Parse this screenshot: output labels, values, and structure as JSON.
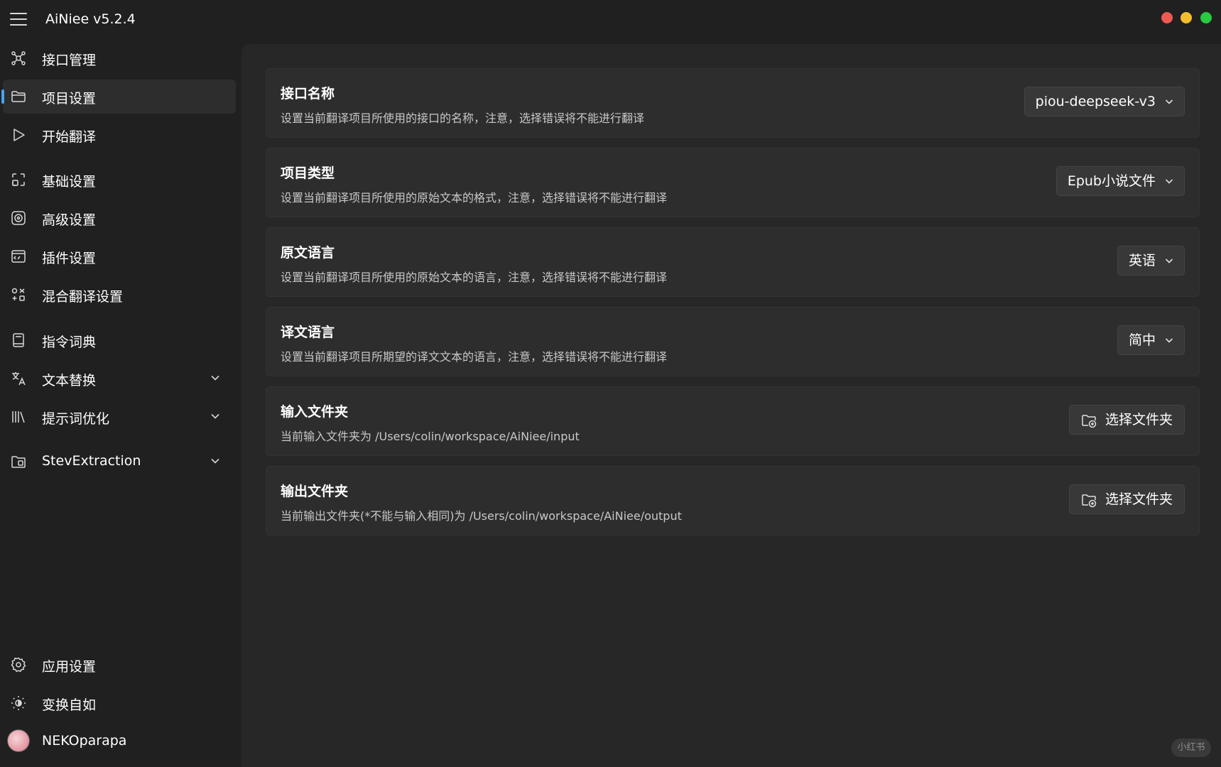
{
  "app": {
    "title": "AiNiee v5.2.4"
  },
  "colors": {
    "accent": "#4aa3f0",
    "background": "#202020",
    "card": "#2d2d2d",
    "close": "#ee5a52",
    "minimize": "#f5bd2e",
    "maximize": "#29c940"
  },
  "sidebar": {
    "items": [
      {
        "label": "接口管理",
        "icon": "network-nodes-icon"
      },
      {
        "label": "项目设置",
        "icon": "folder-icon",
        "active": true
      },
      {
        "label": "开始翻译",
        "icon": "play-icon"
      },
      {
        "label": "基础设置",
        "icon": "frame-icon"
      },
      {
        "label": "高级设置",
        "icon": "target-icon"
      },
      {
        "label": "插件设置",
        "icon": "terminal-icon"
      },
      {
        "label": "混合翻译设置",
        "icon": "mixed-icon"
      },
      {
        "label": "指令词典",
        "icon": "book-icon"
      },
      {
        "label": "文本替换",
        "icon": "translate-icon",
        "expandable": true
      },
      {
        "label": "提示词优化",
        "icon": "library-icon",
        "expandable": true
      },
      {
        "label": "StevExtraction",
        "icon": "extract-icon",
        "expandable": true
      }
    ],
    "footer": [
      {
        "label": "应用设置",
        "icon": "gear-icon"
      },
      {
        "label": "变换自如",
        "icon": "brightness-icon"
      },
      {
        "label": "NEKOparapa",
        "icon": "avatar"
      }
    ]
  },
  "settings": [
    {
      "title": "接口名称",
      "description": "设置当前翻译项目所使用的接口的名称，注意，选择错误将不能进行翻译",
      "control": "dropdown",
      "value": "piou-deepseek-v3"
    },
    {
      "title": "项目类型",
      "description": "设置当前翻译项目所使用的原始文本的格式，注意，选择错误将不能进行翻译",
      "control": "dropdown",
      "value": "Epub小说文件"
    },
    {
      "title": "原文语言",
      "description": "设置当前翻译项目所使用的原始文本的语言，注意，选择错误将不能进行翻译",
      "control": "dropdown",
      "value": "英语"
    },
    {
      "title": "译文语言",
      "description": "设置当前翻译项目所期望的译文文本的语言，注意，选择错误将不能进行翻译",
      "control": "dropdown",
      "value": "简中"
    },
    {
      "title": "输入文件夹",
      "description": "当前输入文件夹为 /Users/colin/workspace/AiNiee/input",
      "control": "button",
      "value": "选择文件夹"
    },
    {
      "title": "输出文件夹",
      "description": "当前输出文件夹(*不能与输入相同)为 /Users/colin/workspace/AiNiee/output",
      "control": "button",
      "value": "选择文件夹"
    }
  ],
  "watermark": "小红书"
}
